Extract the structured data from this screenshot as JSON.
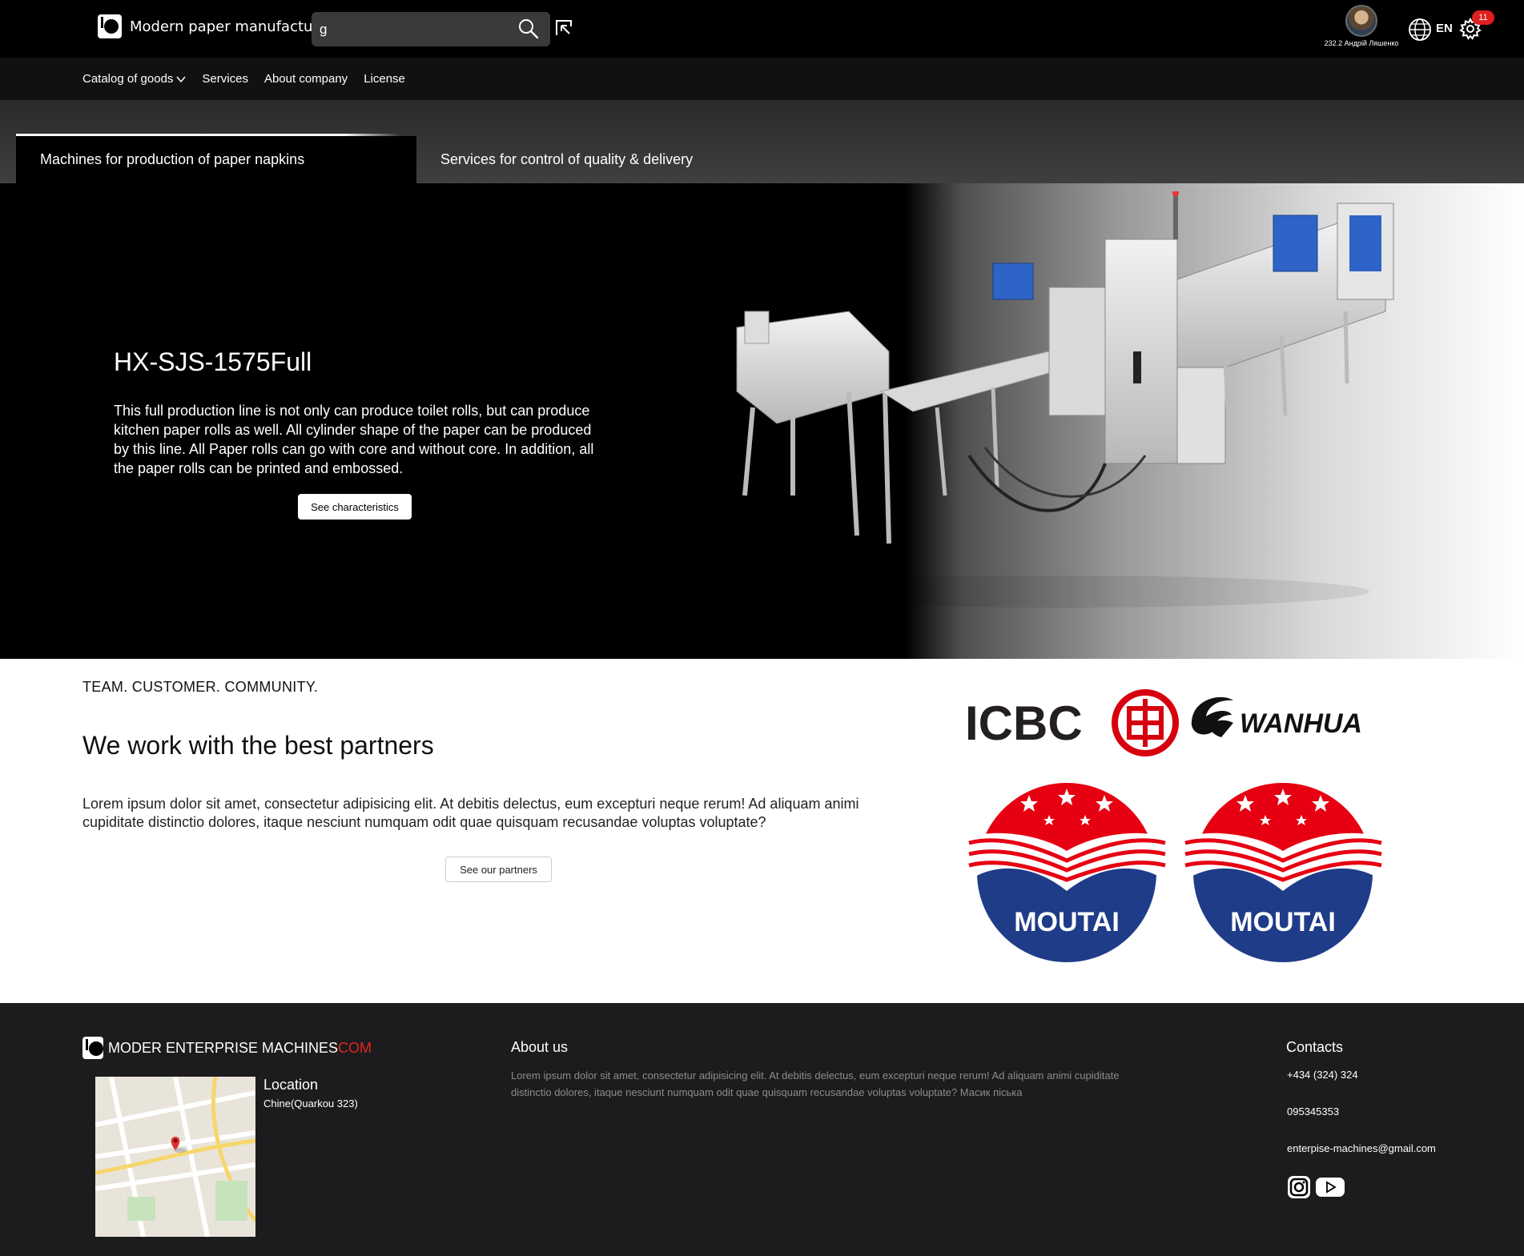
{
  "header": {
    "brand_name": "Modern paper manufacture",
    "search_value": "g",
    "user_name": "232.2 Андрій Ляшенко",
    "language": "EN",
    "notifications_count": "11"
  },
  "nav": {
    "items": [
      {
        "label": "Catalog of goods"
      },
      {
        "label": "Services"
      },
      {
        "label": "About company"
      },
      {
        "label": "License"
      }
    ]
  },
  "tabs": [
    {
      "label": "Machines for production of paper napkins",
      "active": true
    },
    {
      "label": "Services for control of quality & delivery",
      "active": false
    }
  ],
  "hero": {
    "title": "HX-SJS-1575Full",
    "description": "This full production line is not only can produce toilet rolls, but can produce kitchen paper rolls as well. All cylinder shape of the paper can be produced by this line. All Paper rolls can go with core and without core. In addition, all the paper rolls can be printed and embossed.",
    "button_label": "See characteristics"
  },
  "partners": {
    "kicker": "TEAM. CUSTOMER. COMMUNITY.",
    "title": "We work with the best partners",
    "description": "Lorem ipsum dolor sit amet, consectetur adipisicing elit. At debitis delectus, eum excepturi neque rerum! Ad aliquam animi cupiditate distinctio dolores, itaque nesciunt numquam odit quae quisquam recusandae voluptas voluptate?",
    "button_label": "See our partners",
    "logos": [
      "ICBC",
      "WANHUA",
      "MOUTAI",
      "MOUTAI"
    ]
  },
  "footer": {
    "brand_main": "MODER ENTERPRISE MACHINES",
    "brand_accent": "COM",
    "location_title": "Location",
    "location_text": "Chine(Quarkou 323)",
    "about_title": "About us",
    "about_text": "Lorem ipsum dolor sit amet, consectetur adipisicing elit. At debitis delectus, eum excepturi neque rerum! Ad aliquam animi cupiditate distinctio dolores, itaque nesciunt numquam odit quae quisquam recusandae voluptas voluptate? Масик піська",
    "contacts_title": "Contacts",
    "phone_1": "+434 (324) 324",
    "phone_2": "095345353",
    "email": "enterpise-machines@gmail.com"
  },
  "colors": {
    "accent_red": "#e0261b",
    "footer_bg": "#1c1c1e",
    "moutai_red": "#e60012",
    "moutai_blue": "#1f3c88"
  }
}
